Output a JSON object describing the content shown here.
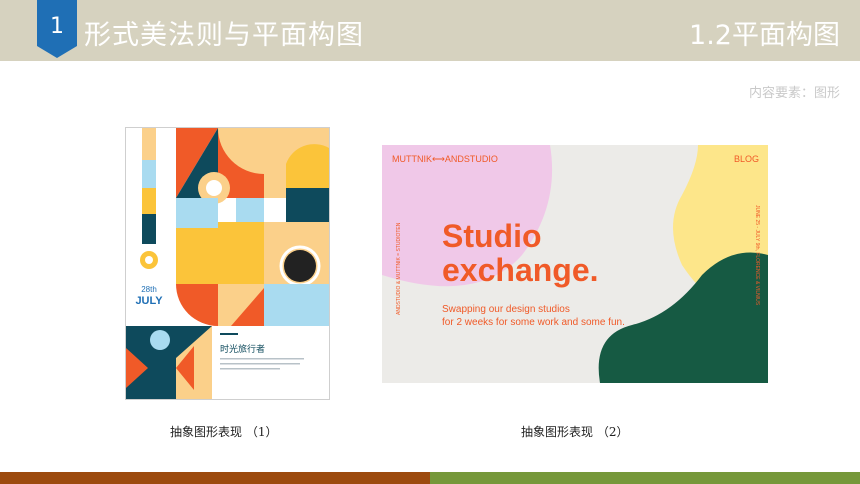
{
  "header": {
    "badge_number": "1",
    "chapter_title": "形式美法则与平面构图",
    "section_title": "1.2平面构图"
  },
  "subtitle": "内容要素：图形",
  "poster": {
    "date_line1": "28th",
    "date_line2": "JULY",
    "title": "时光旅行者"
  },
  "website": {
    "brand": "MUTTNIK⟷ANDSTUDIO",
    "nav_blog": "BLOG",
    "headline_line1": "Studio",
    "headline_line2": "exchange.",
    "tagline_line1": "Swapping our design studios",
    "tagline_line2": "for 2 weeks for some work and some fun.",
    "side_left": "ANDSTUDIO & MUTTNIK = STUDIOTEN",
    "side_right": "JUNE 25 - JULY 9th, FLORENCE & VILNIUS"
  },
  "captions": {
    "left": "抽象图形表现 （1）",
    "right": "抽象图形表现 （2）"
  },
  "colors": {
    "header_bg": "#d6d2bf",
    "badge_blue": "#1f6fb5",
    "footer_brown": "#9c4a0e",
    "footer_green": "#76983a",
    "accent_orange": "#f05a28",
    "dark_teal": "#0e4a5c"
  }
}
